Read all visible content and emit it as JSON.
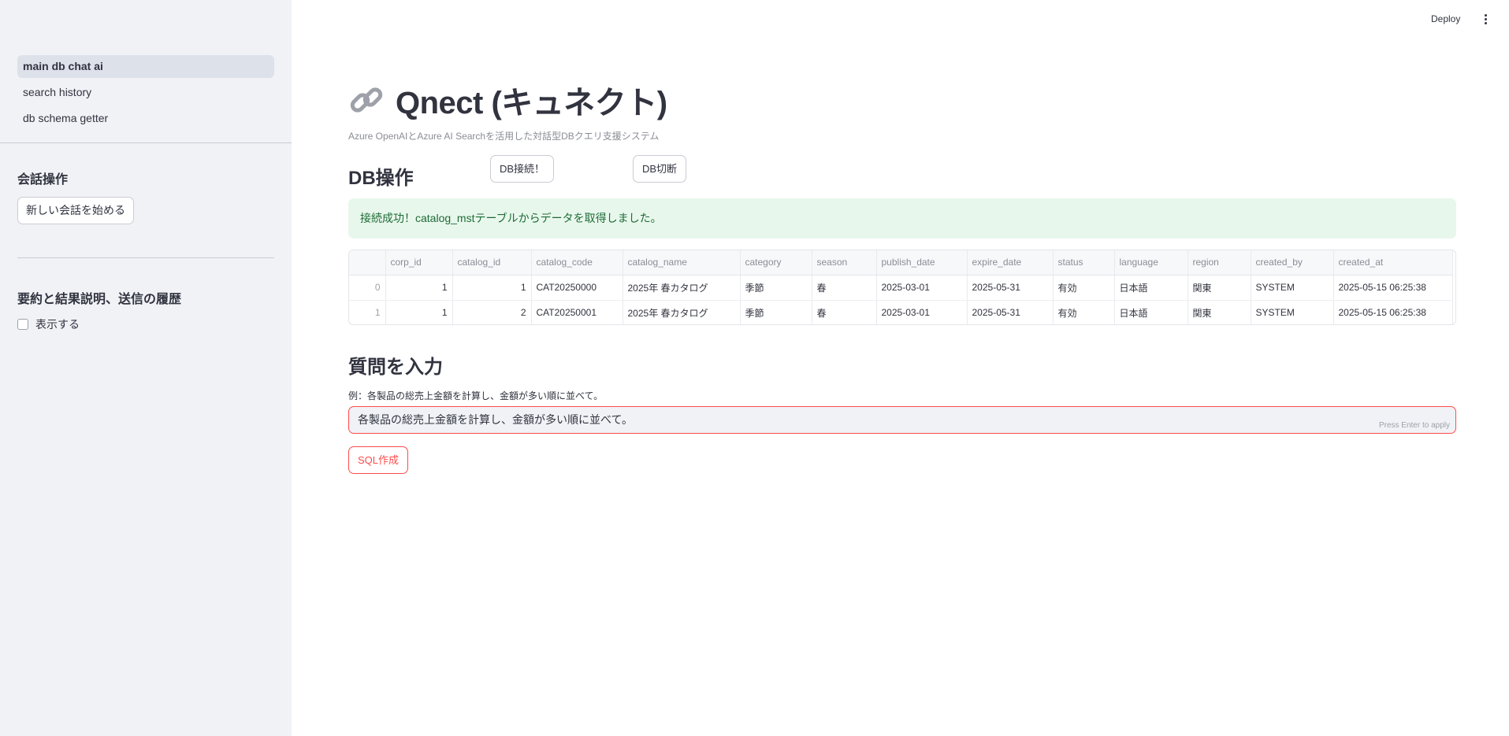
{
  "sidebar": {
    "nav": [
      {
        "label": "main db chat ai",
        "active": true
      },
      {
        "label": "search history",
        "active": false
      },
      {
        "label": "db schema getter",
        "active": false
      }
    ],
    "conversation_title": "会話操作",
    "new_conversation_label": "新しい会話を始める",
    "history_title": "要約と結果説明、送信の履歴",
    "show_checkbox_label": "表示する",
    "show_checkbox_checked": false
  },
  "header": {
    "deploy_label": "Deploy",
    "menu_icon": "vertical-dots-icon"
  },
  "main": {
    "title_icon": "link-icon",
    "title": "Qnect (キュネクト)",
    "subtitle": "Azure OpenAIとAzure AI Searchを活用した対話型DBクエリ支援システム",
    "db_section_title": "DB操作",
    "connect_label": "DB接続！",
    "disconnect_label": "DB切断",
    "success_message": "接続成功！catalog_mstテーブルからデータを取得しました。",
    "table": {
      "columns": [
        "",
        "corp_id",
        "catalog_id",
        "catalog_code",
        "catalog_name",
        "category",
        "season",
        "publish_date",
        "expire_date",
        "status",
        "language",
        "region",
        "created_by",
        "created_at"
      ],
      "rows": [
        [
          "0",
          "1",
          "1",
          "CAT20250000",
          "2025年 春カタログ",
          "季節",
          "春",
          "2025-03-01",
          "2025-05-31",
          "有効",
          "日本語",
          "関東",
          "SYSTEM",
          "2025-05-15 06:25:38"
        ],
        [
          "1",
          "1",
          "2",
          "CAT20250001",
          "2025年 春カタログ",
          "季節",
          "春",
          "2025-03-01",
          "2025-05-31",
          "有効",
          "日本語",
          "関東",
          "SYSTEM",
          "2025-05-15 06:25:38"
        ]
      ]
    },
    "question_section_title": "質問を入力",
    "question_label": "例：各製品の総売上金額を計算し、金額が多い順に並べて。",
    "question_value": "各製品の総売上金額を計算し、金額が多い順に並べて。",
    "question_hint": "Press Enter to apply",
    "sql_button_label": "SQL作成"
  },
  "colors": {
    "sidebar_bg": "#f0f2f6",
    "accent_red": "#ff4b4b",
    "success_bg": "#e8f7ec",
    "success_text": "#1d6b36",
    "text": "#31333f"
  }
}
